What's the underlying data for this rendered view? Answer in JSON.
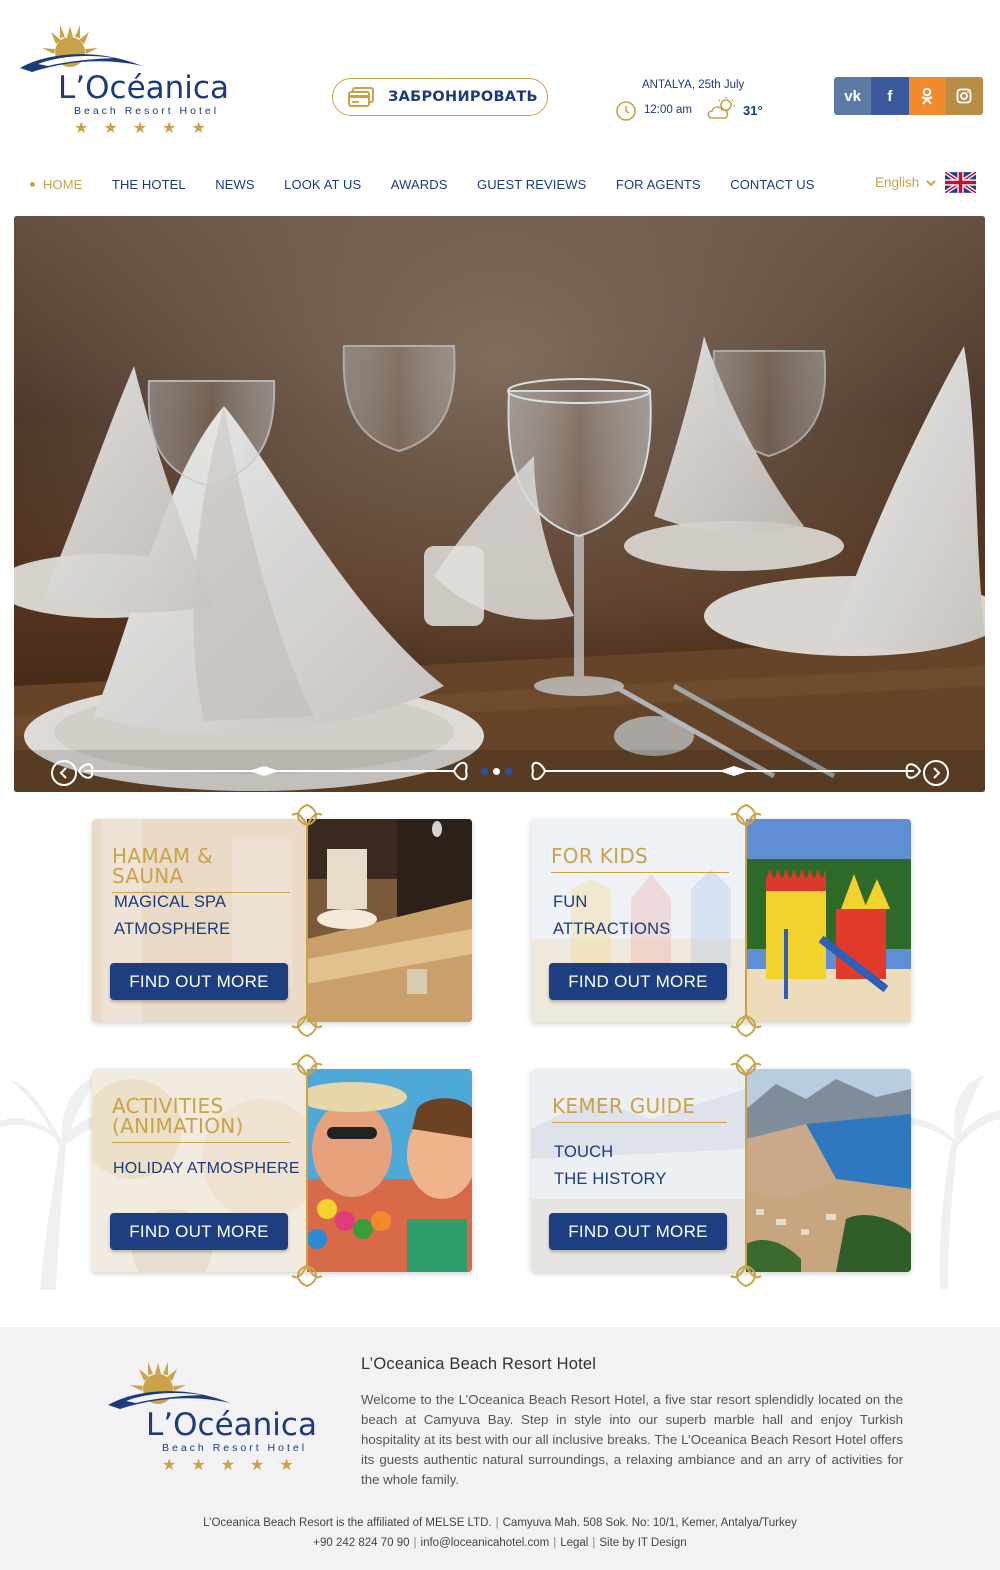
{
  "brand": {
    "name": "L’Océanica",
    "subtitle": "Beach Resort Hotel",
    "stars": "★★★★★"
  },
  "header": {
    "book_label": "ЗАБРОНИРОВАТЬ",
    "weather": {
      "date": "ANTALYA, 25th July",
      "time": "12:00 am",
      "temperature": "31°"
    },
    "social": [
      {
        "name": "vk",
        "glyph": "vk",
        "color": "#5b7ba6"
      },
      {
        "name": "facebook",
        "glyph": "f",
        "color": "#3b5a9c"
      },
      {
        "name": "odnoklassniki",
        "glyph": "ok",
        "color": "#f08a2b"
      },
      {
        "name": "instagram",
        "glyph": "ig",
        "color": "#b78d47"
      }
    ]
  },
  "nav": {
    "items": [
      {
        "label": "HOME",
        "active": true
      },
      {
        "label": "THE HOTEL"
      },
      {
        "label": "NEWS"
      },
      {
        "label": "LOOK AT US"
      },
      {
        "label": "AWARDS"
      },
      {
        "label": "GUEST REVIEWS"
      },
      {
        "label": "FOR AGENTS"
      },
      {
        "label": "CONTACT US"
      }
    ],
    "language": "English"
  },
  "hero": {
    "slides": 3,
    "active_slide": 2
  },
  "cards": [
    {
      "title": "HAMAM & SAUNA",
      "lines": [
        "MAGICAL SPA",
        "ATMOSPHERE"
      ],
      "button": "FIND OUT MORE"
    },
    {
      "title": "FOR KIDS",
      "lines": [
        "FUN",
        "ATTRACTIONS"
      ],
      "button": "FIND OUT MORE"
    },
    {
      "title_lines": [
        "ACTIVITIES",
        "(ANIMATION)"
      ],
      "lines": [
        "HOLIDAY ATMOSPHERE"
      ],
      "button": "FIND OUT MORE"
    },
    {
      "title": "KEMER GUIDE",
      "lines": [
        "TOUCH",
        "THE HISTORY"
      ],
      "button": "FIND OUT MORE"
    }
  ],
  "footer": {
    "title": "L’Oceanica Beach Resort Hotel",
    "text": "Welcome to the L’Oceanica Beach Resort Hotel, a five star resort splendidly located on the beach at Camyuva Bay. Step in style into our superb marble hall and enjoy Turkish hospitality at its best with our all inclusive breaks. The L’Oceanica Beach Resort Hotel offers its guests authentic natural surroundings, a relaxing ambiance and an arry of activities for the whole family.",
    "affiliation": "L’Oceanica Beach Resort is the affiliated of MELSE LTD.",
    "address": "Camyuva Mah. 508 Sok. No: 10/1, Kemer, Antalya/Turkey",
    "phone": "+90 242 824 70 90",
    "email": "info@loceanicahotel.com",
    "legal": "Legal",
    "credit": "Site by IT Design"
  },
  "colors": {
    "navy": "#1c3b7a",
    "gold": "#c9a24a",
    "button": "#1d3f82",
    "footer_bg": "#f2f2f4"
  }
}
